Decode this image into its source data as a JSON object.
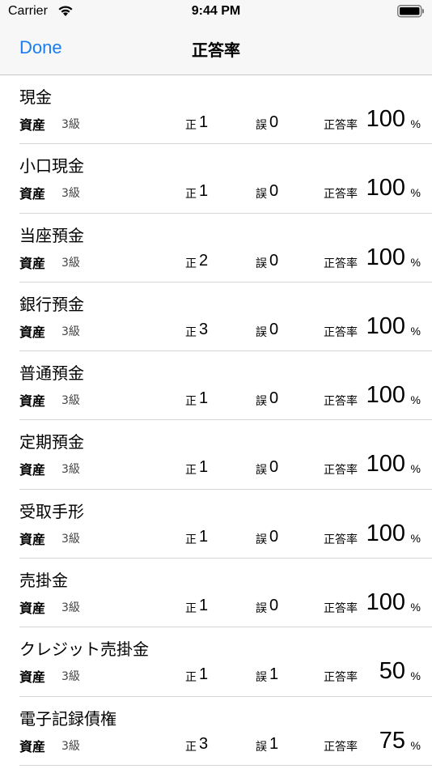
{
  "status_bar": {
    "carrier": "Carrier",
    "time": "9:44 PM"
  },
  "nav": {
    "done_label": "Done",
    "title": "正答率"
  },
  "labels": {
    "correct": "正",
    "wrong": "誤",
    "rate": "正答率",
    "percent": "%"
  },
  "accounts": [
    {
      "name": "現金",
      "category": "資産",
      "grade": "3級",
      "correct": "1",
      "wrong": "0",
      "rate": "100"
    },
    {
      "name": "小口現金",
      "category": "資産",
      "grade": "3級",
      "correct": "1",
      "wrong": "0",
      "rate": "100"
    },
    {
      "name": "当座預金",
      "category": "資産",
      "grade": "3級",
      "correct": "2",
      "wrong": "0",
      "rate": "100"
    },
    {
      "name": "銀行預金",
      "category": "資産",
      "grade": "3級",
      "correct": "3",
      "wrong": "0",
      "rate": "100"
    },
    {
      "name": "普通預金",
      "category": "資産",
      "grade": "3級",
      "correct": "1",
      "wrong": "0",
      "rate": "100"
    },
    {
      "name": "定期預金",
      "category": "資産",
      "grade": "3級",
      "correct": "1",
      "wrong": "0",
      "rate": "100"
    },
    {
      "name": "受取手形",
      "category": "資産",
      "grade": "3級",
      "correct": "1",
      "wrong": "0",
      "rate": "100"
    },
    {
      "name": "売掛金",
      "category": "資産",
      "grade": "3級",
      "correct": "1",
      "wrong": "0",
      "rate": "100"
    },
    {
      "name": "クレジット売掛金",
      "category": "資産",
      "grade": "3級",
      "correct": "1",
      "wrong": "1",
      "rate": "50"
    },
    {
      "name": "電子記録債権",
      "category": "資産",
      "grade": "3級",
      "correct": "3",
      "wrong": "1",
      "rate": "75"
    }
  ]
}
